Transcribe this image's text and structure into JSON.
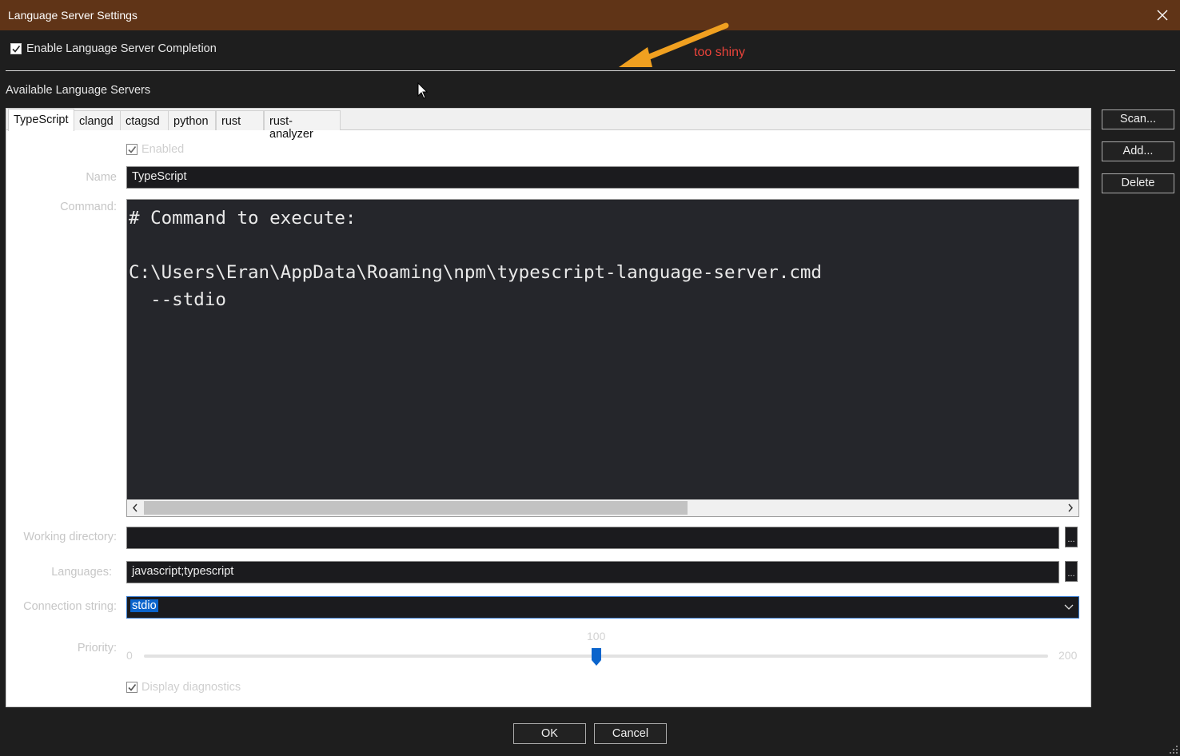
{
  "window": {
    "title": "Language Server Settings"
  },
  "top": {
    "enable_completion_label": "Enable Language Server Completion",
    "enable_completion_checked": true
  },
  "annotation": {
    "text": "too shiny",
    "color": "#e8433a",
    "arrow_color": "#f0a020"
  },
  "section": {
    "label": "Available Language Servers"
  },
  "tabs": [
    {
      "label": "TypeScript",
      "active": true
    },
    {
      "label": "clangd"
    },
    {
      "label": "ctagsd"
    },
    {
      "label": "python"
    },
    {
      "label": "rust"
    },
    {
      "label": "rust-analyzer"
    }
  ],
  "form": {
    "enabled_label": "Enabled",
    "enabled_checked": true,
    "name_label": "Name",
    "name_value": "TypeScript",
    "command_label": "Command:",
    "command_lines": [
      "# Command to execute:",
      "",
      "C:\\Users\\Eran\\AppData\\Roaming\\npm\\typescript-language-server.cmd",
      "  --stdio"
    ],
    "working_dir_label": "Working directory:",
    "working_dir_value": "",
    "languages_label": "Languages:",
    "languages_value": "javascript;typescript",
    "connection_label": "Connection string:",
    "connection_value": "stdio",
    "priority_label": "Priority:",
    "priority_min": "0",
    "priority_max": "200",
    "priority_value": "100",
    "priority_fraction": 0.5,
    "diagnostics_label": "Display diagnostics",
    "diagnostics_checked": true,
    "browse_label": "..."
  },
  "side_buttons": {
    "scan": "Scan...",
    "add": "Add...",
    "delete": "Delete"
  },
  "bottom_buttons": {
    "ok": "OK",
    "cancel": "Cancel"
  },
  "colors": {
    "titlebar": "#603417",
    "accent": "#0a64cc",
    "slider_thumb": "#0a64cc"
  }
}
